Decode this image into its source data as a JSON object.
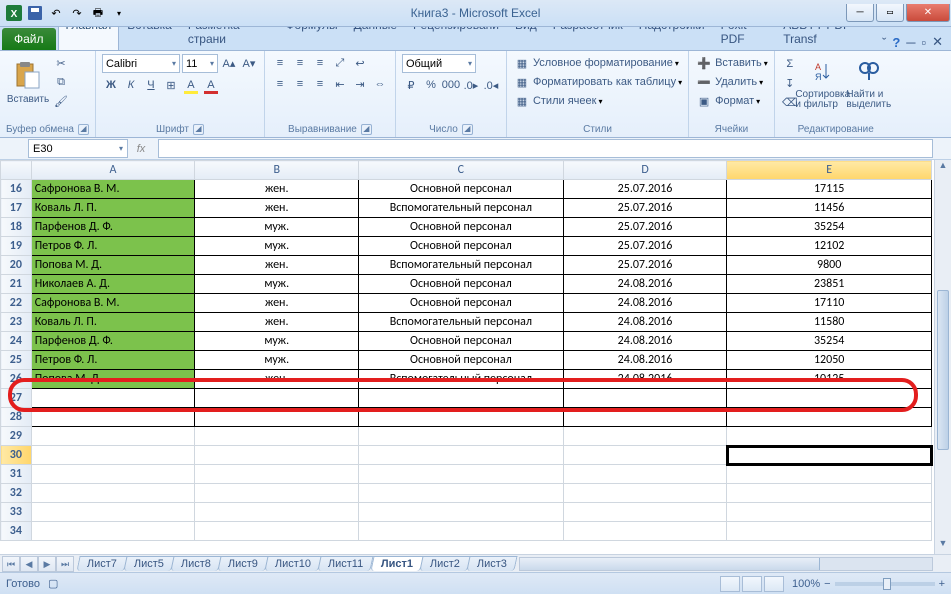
{
  "title": "Книга3  -  Microsoft Excel",
  "file_label": "Файл",
  "tabs": [
    "Главная",
    "Вставка",
    "Разметка страни",
    "Формулы",
    "Данные",
    "Рецензировани",
    "Вид",
    "Разработчик",
    "Надстройки",
    "Foxit PDF",
    "ABBYY PDF Transf"
  ],
  "active_tab": 0,
  "ribbon": {
    "clipboard": {
      "paste": "Вставить",
      "title": "Буфер обмена"
    },
    "font": {
      "name": "Calibri",
      "size": "11",
      "title": "Шрифт"
    },
    "align": {
      "title": "Выравнивание"
    },
    "number": {
      "format": "Общий",
      "title": "Число"
    },
    "styles": {
      "cond": "Условное форматирование",
      "table": "Форматировать как таблицу",
      "cell": "Стили ячеек",
      "title": "Стили"
    },
    "cells": {
      "ins": "Вставить",
      "del": "Удалить",
      "fmt": "Формат",
      "title": "Ячейки"
    },
    "editing": {
      "sort": "Сортировка и фильтр",
      "find": "Найти и выделить",
      "title": "Редактирование"
    }
  },
  "namebox": "E30",
  "formula": "",
  "columns": [
    "A",
    "B",
    "C",
    "D",
    "E"
  ],
  "selected_column": "E",
  "selected_row": 30,
  "first_row": 16,
  "col_widths": {
    "A": 160,
    "B": 160,
    "C": 200,
    "D": 160,
    "E": 200
  },
  "rows": [
    {
      "n": 16,
      "A": "Сафронова В. М.",
      "B": "жен.",
      "C": "Основной персонал",
      "D": "25.07.2016",
      "E": "17115"
    },
    {
      "n": 17,
      "A": "Коваль Л. П.",
      "B": "жен.",
      "C": "Вспомогательный персонал",
      "D": "25.07.2016",
      "E": "11456"
    },
    {
      "n": 18,
      "A": "Парфенов Д. Ф.",
      "B": "муж.",
      "C": "Основной персонал",
      "D": "25.07.2016",
      "E": "35254"
    },
    {
      "n": 19,
      "A": "Петров Ф. Л.",
      "B": "муж.",
      "C": "Основной персонал",
      "D": "25.07.2016",
      "E": "12102"
    },
    {
      "n": 20,
      "A": "Попова М. Д.",
      "B": "жен.",
      "C": "Вспомогательный персонал",
      "D": "25.07.2016",
      "E": "9800"
    },
    {
      "n": 21,
      "A": "Николаев А. Д.",
      "B": "муж.",
      "C": "Основной персонал",
      "D": "24.08.2016",
      "E": "23851"
    },
    {
      "n": 22,
      "A": "Сафронова В. М.",
      "B": "жен.",
      "C": "Основной персонал",
      "D": "24.08.2016",
      "E": "17110"
    },
    {
      "n": 23,
      "A": "Коваль Л. П.",
      "B": "жен.",
      "C": "Вспомогательный персонал",
      "D": "24.08.2016",
      "E": "11580"
    },
    {
      "n": 24,
      "A": "Парфенов Д. Ф.",
      "B": "муж.",
      "C": "Основной персонал",
      "D": "24.08.2016",
      "E": "35254"
    },
    {
      "n": 25,
      "A": "Петров Ф. Л.",
      "B": "муж.",
      "C": "Основной персонал",
      "D": "24.08.2016",
      "E": "12050"
    },
    {
      "n": 26,
      "A": "Попова М. Д.",
      "B": "жен.",
      "C": "Вспомогательный персонал",
      "D": "24.08.2016",
      "E": "10125"
    }
  ],
  "empty_rows": [
    27,
    28,
    29,
    30,
    31,
    32,
    33,
    34
  ],
  "sheets": [
    "Лист7",
    "Лист5",
    "Лист8",
    "Лист9",
    "Лист10",
    "Лист11",
    "Лист1",
    "Лист2",
    "Лист3"
  ],
  "active_sheet": "Лист1",
  "status": "Готово",
  "zoom": "100%"
}
